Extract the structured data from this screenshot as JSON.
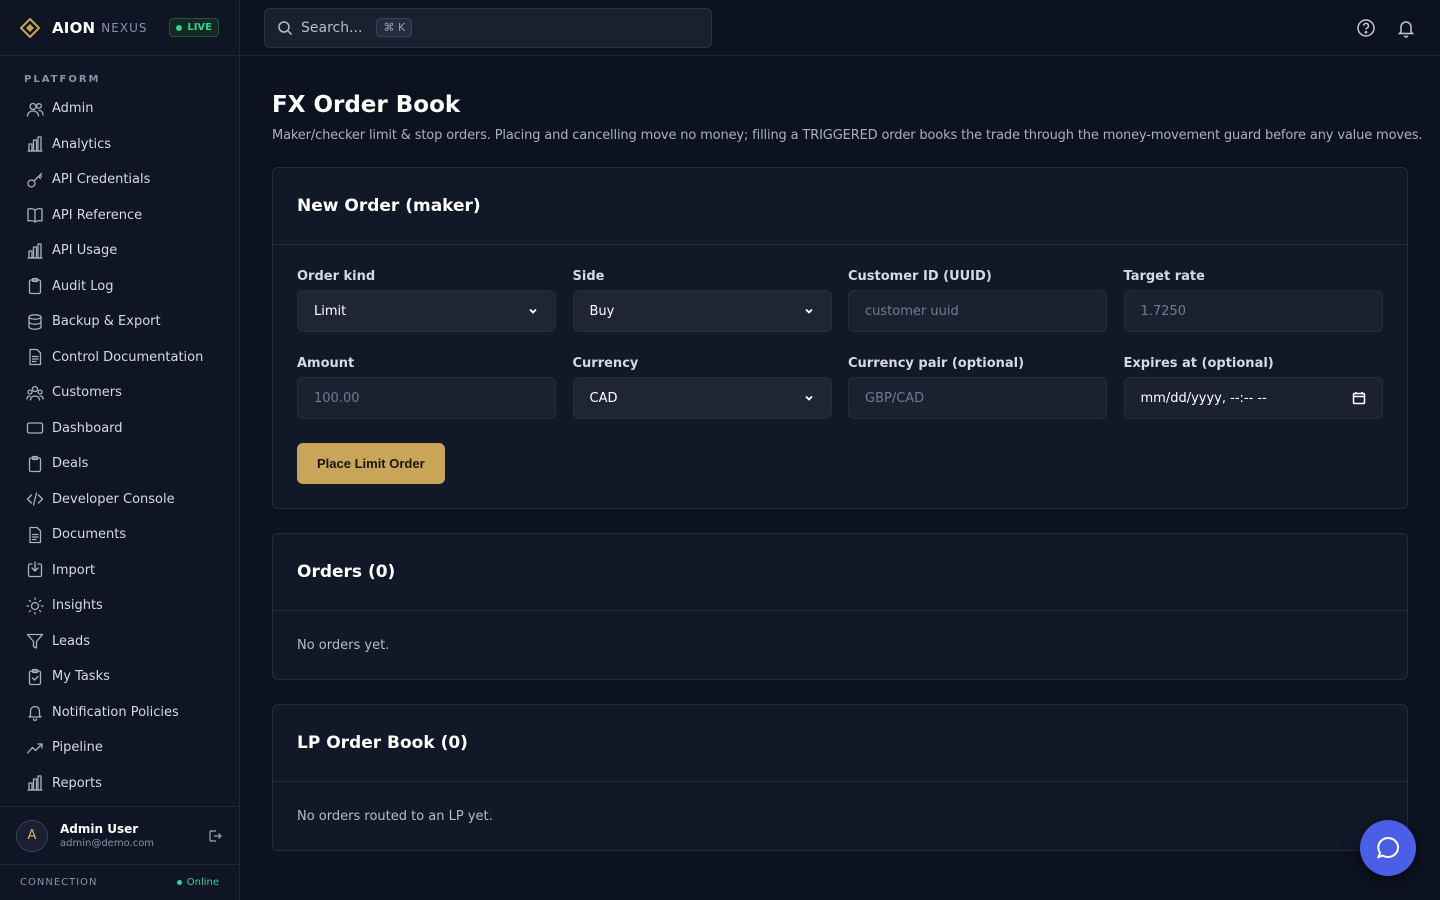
{
  "brand": {
    "name": "AION",
    "sub": "NEXUS",
    "live": "LIVE"
  },
  "sidebar": {
    "section": "PLATFORM",
    "items": [
      {
        "label": "Admin",
        "icon": "users-icon"
      },
      {
        "label": "Analytics",
        "icon": "bar-chart-icon"
      },
      {
        "label": "API Credentials",
        "icon": "key-icon"
      },
      {
        "label": "API Reference",
        "icon": "book-icon"
      },
      {
        "label": "API Usage",
        "icon": "bar-chart-icon"
      },
      {
        "label": "Audit Log",
        "icon": "clipboard-icon"
      },
      {
        "label": "Backup & Export",
        "icon": "database-icon"
      },
      {
        "label": "Control Documentation",
        "icon": "file-icon"
      },
      {
        "label": "Customers",
        "icon": "customers-icon"
      },
      {
        "label": "Dashboard",
        "icon": "monitor-icon"
      },
      {
        "label": "Deals",
        "icon": "clipboard-icon"
      },
      {
        "label": "Developer Console",
        "icon": "code-icon"
      },
      {
        "label": "Documents",
        "icon": "file-icon"
      },
      {
        "label": "Import",
        "icon": "import-icon"
      },
      {
        "label": "Insights",
        "icon": "lightbulb-icon"
      },
      {
        "label": "Leads",
        "icon": "funnel-icon"
      },
      {
        "label": "My Tasks",
        "icon": "clipboard-check-icon"
      },
      {
        "label": "Notification Policies",
        "icon": "bell-icon"
      },
      {
        "label": "Pipeline",
        "icon": "trending-icon"
      },
      {
        "label": "Reports",
        "icon": "bar-chart-icon"
      }
    ]
  },
  "user": {
    "initial": "A",
    "name": "Admin User",
    "email": "admin@demo.com"
  },
  "connection": {
    "label": "CONNECTION",
    "status": "Online"
  },
  "search": {
    "placeholder": "Search...",
    "shortcut": "⌘ K"
  },
  "page": {
    "title": "FX Order Book",
    "description": "Maker/checker limit & stop orders. Placing and cancelling move no money; filling a TRIGGERED order books the trade through the money-movement guard before any value moves."
  },
  "new_order": {
    "title": "New Order (maker)",
    "fields": {
      "order_kind": {
        "label": "Order kind",
        "value": "Limit"
      },
      "side": {
        "label": "Side",
        "value": "Buy"
      },
      "customer_id": {
        "label": "Customer ID (UUID)",
        "placeholder": "customer uuid"
      },
      "target_rate": {
        "label": "Target rate",
        "placeholder": "1.7250"
      },
      "amount": {
        "label": "Amount",
        "placeholder": "100.00"
      },
      "currency": {
        "label": "Currency",
        "value": "CAD"
      },
      "currency_pair": {
        "label": "Currency pair (optional)",
        "placeholder": "GBP/CAD"
      },
      "expires_at": {
        "label": "Expires at (optional)",
        "value": "mm/dd/yyyy, --:-- --"
      }
    },
    "submit": "Place Limit Order"
  },
  "orders": {
    "title": "Orders (0)",
    "empty": "No orders yet."
  },
  "lp_orders": {
    "title": "LP Order Book (0)",
    "empty": "No orders routed to an LP yet."
  },
  "colors": {
    "accent": "#c9a55a",
    "live": "#34d399",
    "fab": "#4a5ee8",
    "bg": "#0d1220"
  }
}
